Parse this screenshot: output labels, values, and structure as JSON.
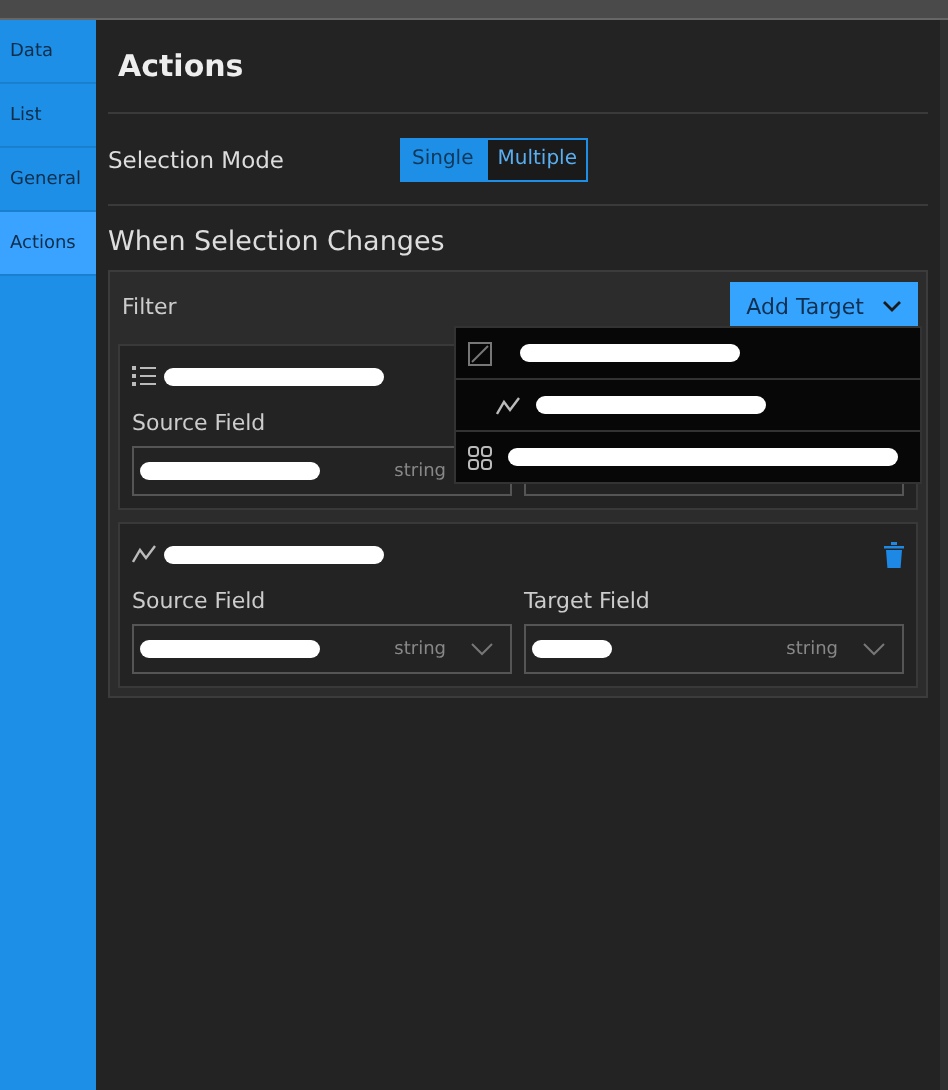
{
  "sidebar": {
    "items": [
      {
        "label": "Data",
        "selected": false
      },
      {
        "label": "List",
        "selected": false
      },
      {
        "label": "General",
        "selected": false
      },
      {
        "label": "Actions",
        "selected": true
      }
    ]
  },
  "title": "Actions",
  "selection_mode": {
    "label": "Selection Mode",
    "options": [
      {
        "label": "Single",
        "selected": true
      },
      {
        "label": "Multiple",
        "selected": false
      }
    ]
  },
  "section_title": "When Selection Changes",
  "filter": {
    "label": "Filter",
    "add_button": "Add Target",
    "targets": [
      {
        "kind": "list",
        "source": {
          "label": "Source Field",
          "type": "string"
        }
      },
      {
        "kind": "line",
        "deletable": true,
        "source": {
          "label": "Source Field",
          "type": "string",
          "arrow": true
        },
        "target": {
          "label": "Target Field",
          "type": "string"
        }
      }
    ],
    "menu": [
      {
        "kind": "map"
      },
      {
        "kind": "line"
      },
      {
        "kind": "grid"
      }
    ]
  }
}
